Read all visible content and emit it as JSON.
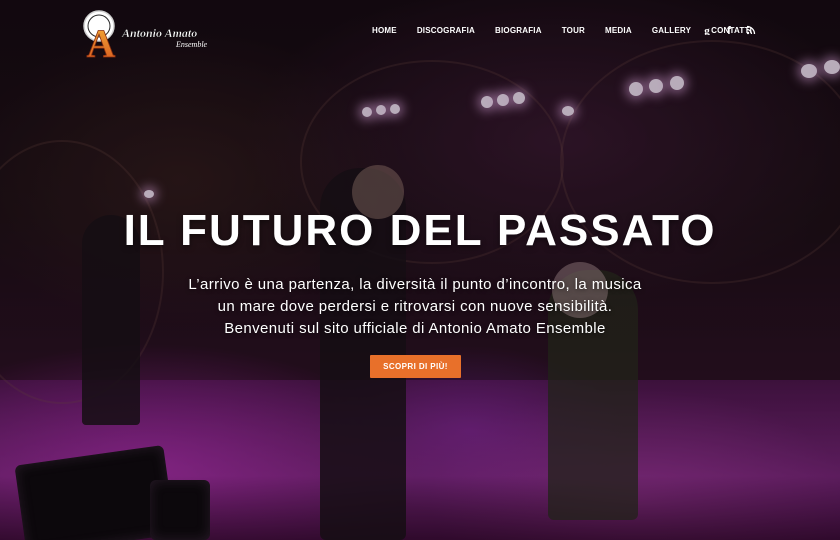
{
  "brand": {
    "logo_letter": "A",
    "logo_name": "Antonio Amato",
    "logo_tag": "Ensemble"
  },
  "nav": {
    "items": [
      {
        "label": "HOME"
      },
      {
        "label": "DISCOGRAFIA"
      },
      {
        "label": "BIOGRAFIA"
      },
      {
        "label": "TOUR"
      },
      {
        "label": "MEDIA"
      },
      {
        "label": "GALLERY"
      },
      {
        "label": "CONTATTI"
      }
    ],
    "social": [
      {
        "icon": "google-plus-icon"
      },
      {
        "icon": "facebook-icon"
      },
      {
        "icon": "rss-icon"
      }
    ]
  },
  "hero": {
    "title": "IL FUTURO DEL PASSATO",
    "lines": [
      "L’arrivo è una partenza, la diversità il punto d’incontro, la musica",
      "un mare dove perdersi e ritrovarsi con nuove sensibilità.",
      "Benvenuti sul sito ufficiale di Antonio Amato Ensemble"
    ],
    "cta_label": "SCOPRI DI PIÙ!"
  },
  "colors": {
    "accent": "#e8702a",
    "stage_light": "#c23cc8",
    "text": "#ffffff"
  }
}
